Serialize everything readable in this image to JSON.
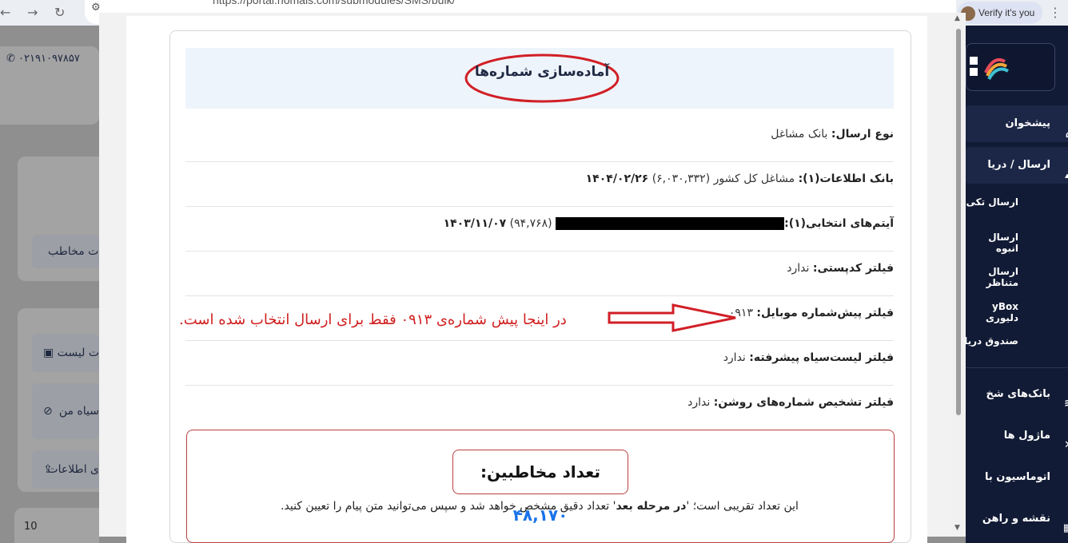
{
  "browser": {
    "url": "https://portal.nomais.com/submodules/SMS/bulk/",
    "profile_label": "Verify it's you"
  },
  "page": {
    "phone": "۰۲۱۹۱۰۹۷۸۵۷",
    "contact_btn": "ت مخاطب",
    "list_btn": "ت لیست",
    "blacklist_btn": "سیاه من",
    "import_btn": "ی اطلاعات",
    "chart_y_tick": "10"
  },
  "sidebar": {
    "dashboard": "پیشخوان",
    "send_receive": "ارسال / دریا",
    "single_send": "ارسال تکی",
    "bulk_send": "ارسال انبوه",
    "match_send": "ارسال متناظر",
    "mybox": "yBox دلیوری",
    "inbox": "صندوق دریاف",
    "banks": "بانک‌های شخ",
    "modules": "ماژول ها",
    "automation": "اتوماسیون با",
    "roadmap": "نقشه و راهن"
  },
  "modal": {
    "title": "آماده‌سازی شماره‌ها",
    "rows": [
      {
        "label": "نوع ارسال:",
        "value": "بانک مشاغل"
      },
      {
        "label": "بانک اطلاعات(۱):",
        "value": "مشاغل کل کشور (۶,۰۳۰,۳۳۲)",
        "date": "۱۴۰۴/۰۲/۲۶"
      },
      {
        "label": "آیتم‌های انتخابی(۱):",
        "value": "(۹۴,۷۶۸)",
        "date": "۱۴۰۳/۱۱/۰۷"
      },
      {
        "label": "فیلتر کدپستی:",
        "value": "ندارد"
      },
      {
        "label": "فیلتر پیش‌شماره موبایل:",
        "value": "۰۹۱۳"
      },
      {
        "label": "فیلتر لیست‌سیاه پیشرفته:",
        "value": "ندارد"
      },
      {
        "label": "فیلتر تشخیص شماره‌های روشن:",
        "value": "ندارد"
      }
    ],
    "annotation": "در اینجا پیش شماره‌ی ۰۹۱۳ فقط برای ارسال انتخاب شده است.",
    "count_label": "تعداد مخاطبین:",
    "count_value": "۴۸,۱۷۰",
    "desc_prefix": "این تعداد تقریبی است؛ '",
    "desc_bold": "در مرحله بعد",
    "desc_suffix": "' تعداد دقیق مشخص خواهد شد و سپس می‌توانید متن پیام را تعیین کنید."
  },
  "colors": {
    "annotation": "#d02020",
    "count_number": "#1a73e8",
    "sidebar_bg": "#121b35",
    "active_border": "#f0a23a"
  }
}
